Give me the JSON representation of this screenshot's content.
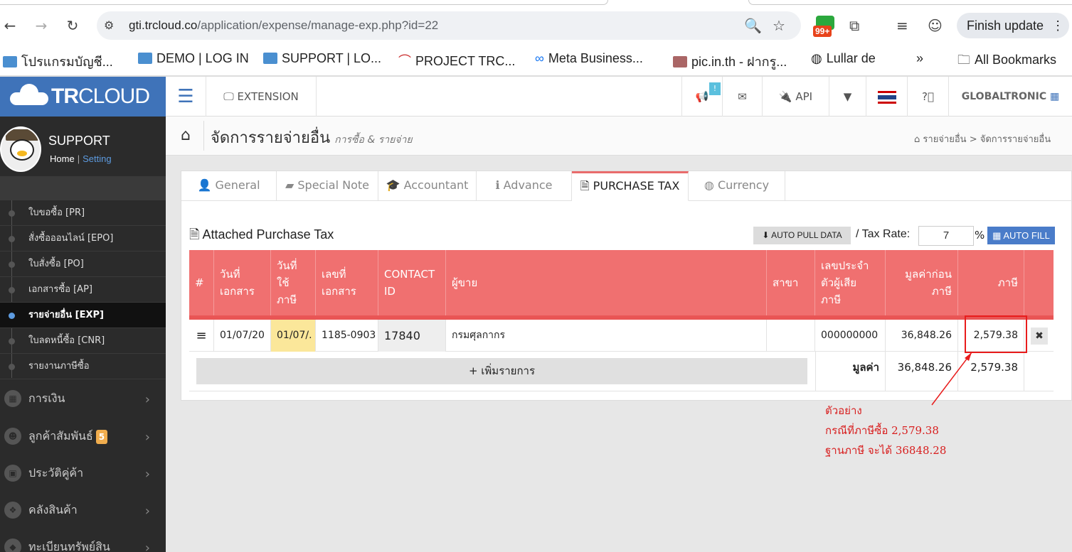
{
  "browser": {
    "url_host": "gti.trcloud.co",
    "url_path": "/application/expense/manage-exp.php?id=22",
    "ext_badge": "99+",
    "finish_update": "Finish update",
    "bookmarks": [
      "โปรแกรมบัญชี...",
      "DEMO | LOG IN",
      "SUPPORT | LO...",
      "PROJECT TRC...",
      "Meta Business...",
      "pic.in.th - ฝากรู...",
      "Lullar de",
      "»",
      "All Bookmarks"
    ]
  },
  "app": {
    "logo_bold": "TR",
    "logo_light": "CLOUD",
    "topbar": {
      "extension": "EXTENSION",
      "notify_badge": "!",
      "api": "API",
      "company": "GLOBALTRONIC"
    },
    "user": {
      "name": "SUPPORT",
      "home": "Home",
      "setting": "Setting"
    },
    "sidebar": {
      "submenu": [
        "ใบขอซื้อ [PR]",
        "สั่งซื้อออนไลน์ [EPO]",
        "ใบสั่งซื้อ [PO]",
        "เอกสารซื้อ [AP]",
        "รายจ่ายอื่น [EXP]",
        "ใบลดหนี้ซื้อ [CNR]",
        "รายงานภาษีซื้อ"
      ],
      "main": [
        "การเงิน",
        "ลูกค้าสัมพันธ์",
        "ประวัติคู่ค้า",
        "คลังสินค้า",
        "ทะเบียนทรัพย์สิน"
      ],
      "crm_badge": "5"
    }
  },
  "page": {
    "title": "จัดการรายจ่ายอื่น",
    "subtitle": "การซื้อ & รายจ่าย",
    "crumb1": "รายจ่ายอื่น",
    "crumb_sep": ">",
    "crumb2": "จัดการรายจ่ายอื่น"
  },
  "tabs": [
    "General",
    "Special Note",
    "Accountant",
    "Advance",
    "PURCHASE TAX",
    "Currency"
  ],
  "purchase_tax": {
    "section_title": "Attached Purchase Tax",
    "auto_pull": "AUTO PULL DATA",
    "tax_rate_label": "/ Tax Rate:",
    "tax_rate": "7",
    "pct": "%",
    "auto_fill": "AUTO FILL",
    "columns": [
      "#",
      "วันที่\nเอกสาร",
      "วันที่ใช้\nภาษี",
      "เลขที่\nเอกสาร",
      "CONTACT\nID",
      "ผู้ขาย",
      "สาขา",
      "เลขประจำ\nตัวผู้เสีย\nภาษี",
      "มูลค่าก่อน\nภาษี",
      "ภาษี"
    ],
    "row": {
      "handle": "≡",
      "doc_date": "01/07/20",
      "tax_date": "01/07/.",
      "doc_no": "1185-0903",
      "contact_id": "17840",
      "vendor": "กรมศุลกากร",
      "branch": "",
      "tax_id": "000000000",
      "amount": "36,848.26",
      "tax": "2,579.38",
      "delete": "✖"
    },
    "add_row": "+ เพิ่มรายการ",
    "total_label": "มูลค่า",
    "total_amount": "36,848.26",
    "total_tax": "2,579.38"
  },
  "annotation": {
    "line1": "ตัวอย่าง",
    "line2": "กรณีที่ภาษีซื้อ 2,579.38",
    "line3": "ฐานภาษี จะได้ 36848.28"
  },
  "colors": {
    "brand": "#3f73b9",
    "table_header": "#f07070",
    "annotation": "#d81e1e"
  }
}
